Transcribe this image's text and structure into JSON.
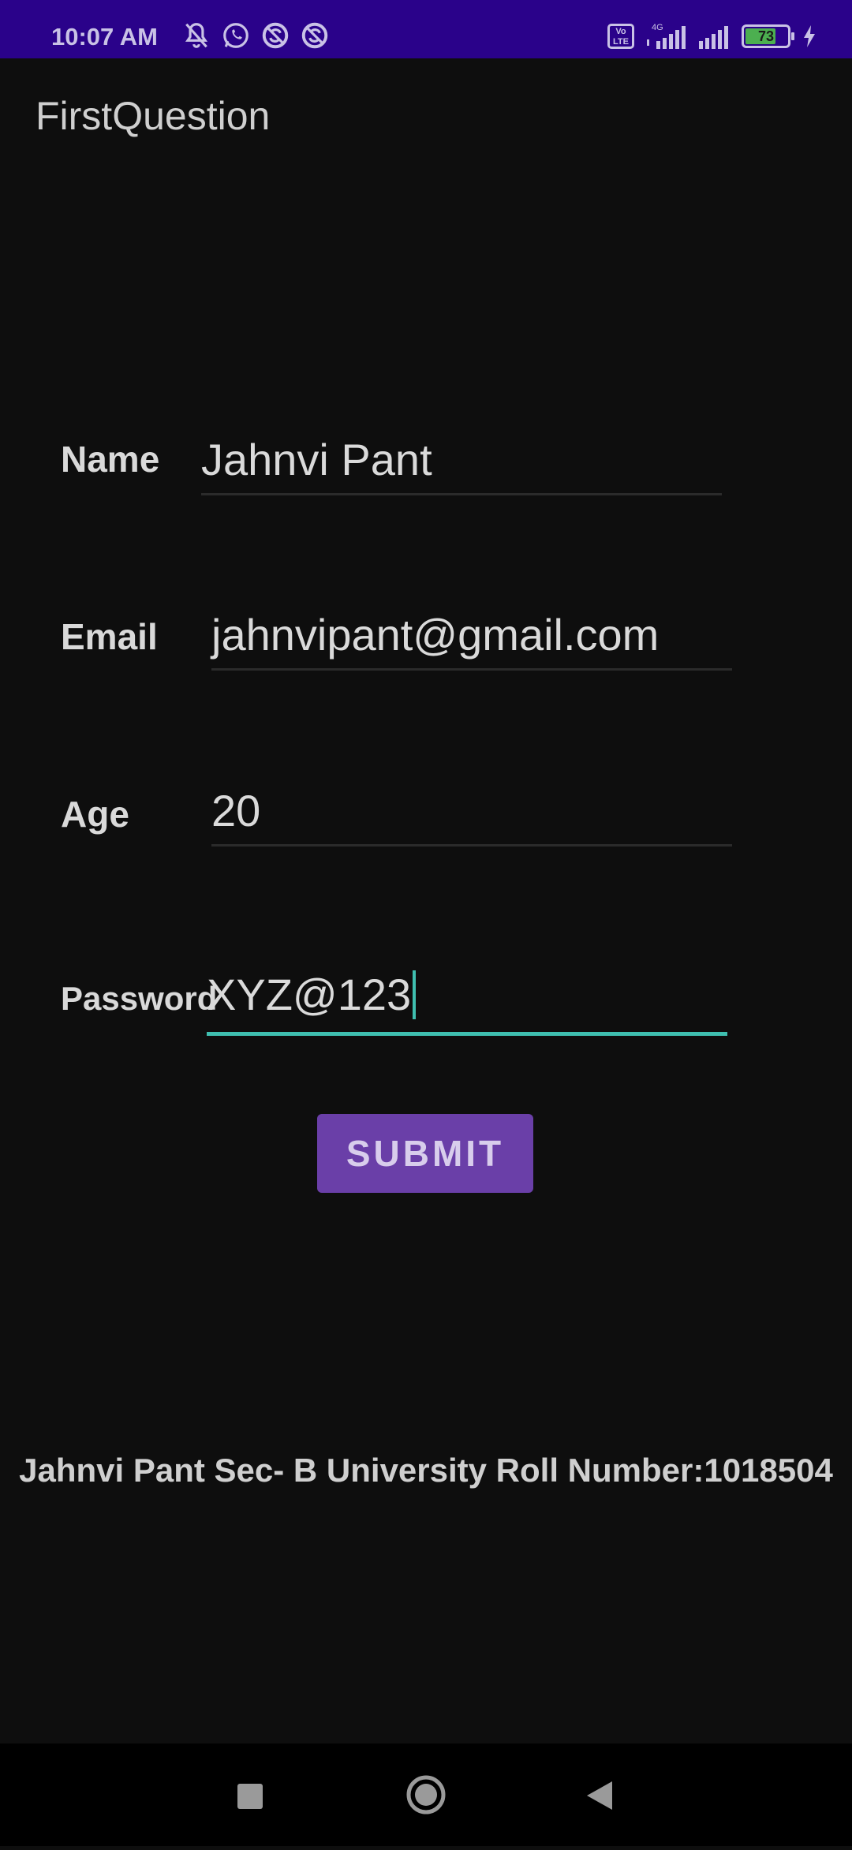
{
  "status_bar": {
    "time": "10:07 AM",
    "left_icons": [
      "muted-bell-icon",
      "whatsapp-icon",
      "sync-icon",
      "sync-icon"
    ],
    "volte_label": "Vo\nLTE",
    "network": "4G",
    "battery_level": "73",
    "battery_fraction": 0.73,
    "charging": true
  },
  "app": {
    "title": "FirstQuestion"
  },
  "form": {
    "name": {
      "label": "Name",
      "value": "Jahnvi Pant"
    },
    "email": {
      "label": "Email",
      "value": "jahnvipant@gmail.com"
    },
    "age": {
      "label": "Age",
      "value": "20"
    },
    "password": {
      "label": "Password",
      "value": "XYZ@123"
    },
    "submit_label": "SUBMIT"
  },
  "footer": {
    "text": "Jahnvi Pant Sec- B University Roll Number:1018504"
  },
  "colors": {
    "status_bar": "#2a028a",
    "background": "#0e0e0e",
    "accent": "#3fbfb0",
    "button": "#6a3fa8"
  },
  "nav_bar": {
    "buttons": [
      "recent-apps-icon",
      "home-icon",
      "back-icon"
    ]
  }
}
